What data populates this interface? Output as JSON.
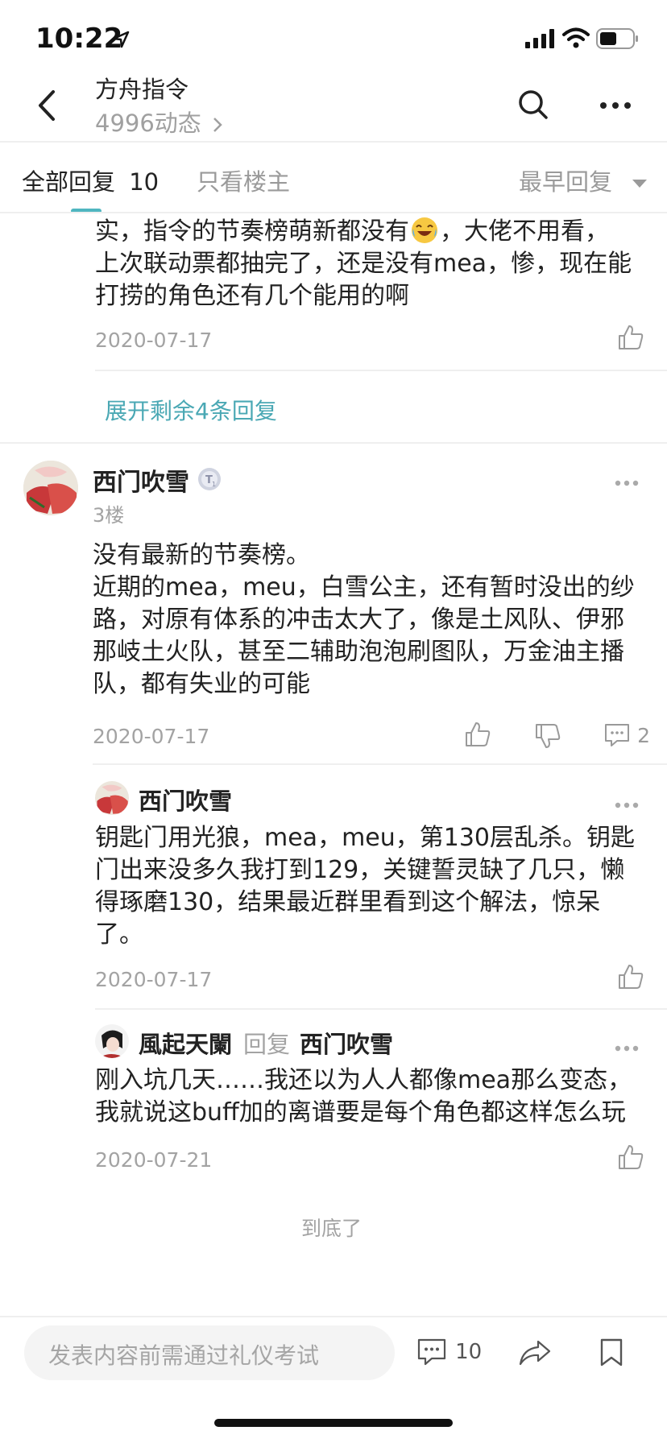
{
  "status_bar": {
    "time": "10:22"
  },
  "nav": {
    "title": "方舟指令",
    "subtitle": "4996动态"
  },
  "tabs": {
    "all_replies": "全部回复",
    "reply_count": "10",
    "op_only": "只看楼主",
    "sort": "最早回复"
  },
  "prev_reply": {
    "lines": [
      "实，指令的节奏榜萌新都没有",
      "，大佬不用看，",
      "上次联动票都抽完了，还是没有mea，惨，现在能",
      "打捞的角色还有几个能用的啊"
    ],
    "date": "2020-07-17",
    "expand_label": "展开剩余4条回复"
  },
  "post": {
    "author": "西门吹雪",
    "floor": "3楼",
    "lines": [
      "没有最新的节奏榜。",
      "近期的mea，meu，白雪公主，还有暂时没出的纱",
      "路，对原有体系的冲击太大了，像是土风队、伊邪",
      "那岐土火队，甚至二辅助泡泡刷图队，万金油主播",
      "队，都有失业的可能"
    ],
    "date": "2020-07-17",
    "comment_count": "2"
  },
  "reply1": {
    "author": "西门吹雪",
    "lines": [
      "钥匙门用光狼，mea，meu，第130层乱杀。钥匙",
      "门出来没多久我打到129，关键誓灵缺了几只，懒",
      "得琢磨130，结果最近群里看到这个解法，惊呆",
      "了。"
    ],
    "date": "2020-07-17"
  },
  "reply2": {
    "author": "風起天闌",
    "reply_word": "回复",
    "reply_to": "西门吹雪",
    "lines": [
      "刚入坑几天……我还以为人人都像mea那么变态，",
      "我就说这buff加的离谱要是每个角色都这样怎么玩"
    ],
    "date": "2020-07-21"
  },
  "end_text": "到底了",
  "bottom_bar": {
    "input_placeholder": "发表内容前需通过礼仪考试",
    "comment_count": "10"
  },
  "colors": {
    "accent": "#4fb6c0",
    "link": "#4aa8b4",
    "text": "#222222",
    "muted": "#a3a3a3"
  }
}
